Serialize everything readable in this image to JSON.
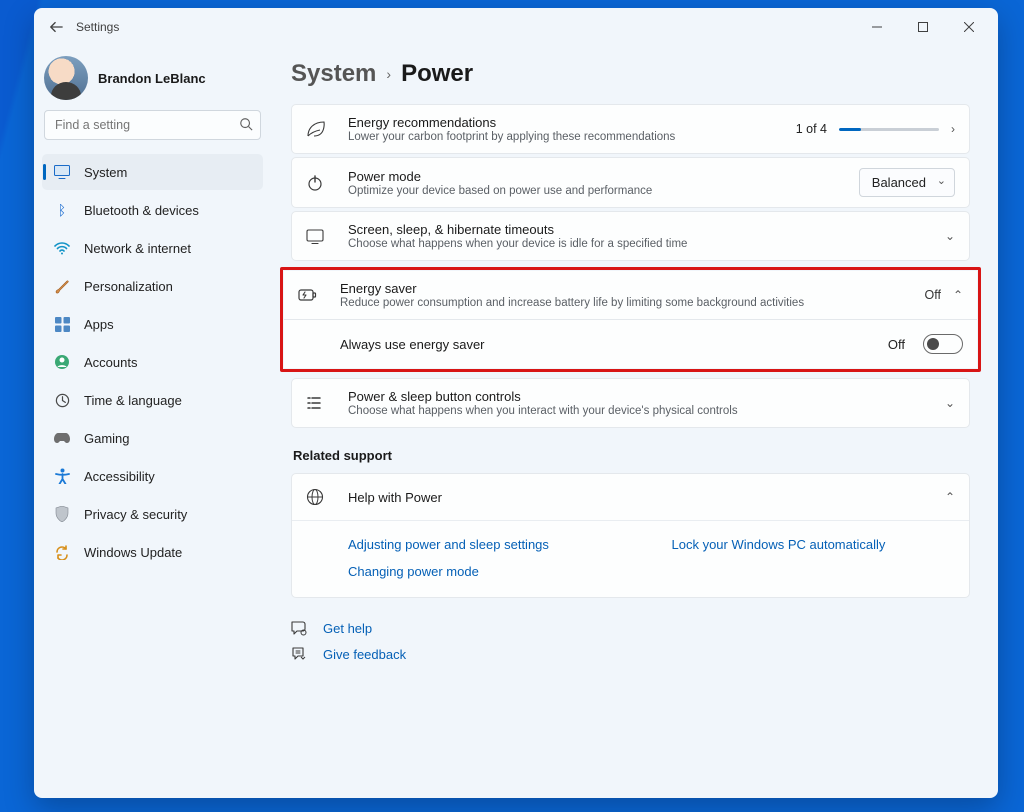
{
  "window": {
    "title": "Settings"
  },
  "profile": {
    "name": "Brandon LeBlanc"
  },
  "search": {
    "placeholder": "Find a setting"
  },
  "sidebar": {
    "items": [
      {
        "label": "System"
      },
      {
        "label": "Bluetooth & devices"
      },
      {
        "label": "Network & internet"
      },
      {
        "label": "Personalization"
      },
      {
        "label": "Apps"
      },
      {
        "label": "Accounts"
      },
      {
        "label": "Time & language"
      },
      {
        "label": "Gaming"
      },
      {
        "label": "Accessibility"
      },
      {
        "label": "Privacy & security"
      },
      {
        "label": "Windows Update"
      }
    ]
  },
  "breadcrumb": {
    "parent": "System",
    "page": "Power"
  },
  "cards": {
    "energyRec": {
      "title": "Energy recommendations",
      "sub": "Lower your carbon footprint by applying these recommendations",
      "counter": "1 of 4"
    },
    "powerMode": {
      "title": "Power mode",
      "sub": "Optimize your device based on power use and performance",
      "value": "Balanced"
    },
    "screenSleep": {
      "title": "Screen, sleep, & hibernate timeouts",
      "sub": "Choose what happens when your device is idle for a specified time"
    },
    "energySaver": {
      "title": "Energy saver",
      "sub": "Reduce power consumption and increase battery life by limiting some background activities",
      "state": "Off",
      "sub_title": "Always use energy saver",
      "toggle_state": "Off"
    },
    "powerButtons": {
      "title": "Power & sleep button controls",
      "sub": "Choose what happens when you interact with your device's physical controls"
    }
  },
  "related": {
    "heading": "Related support"
  },
  "support": {
    "title": "Help with Power",
    "links": [
      "Adjusting power and sleep settings",
      "Lock your Windows PC automatically",
      "Changing power mode"
    ]
  },
  "footer": {
    "getHelp": "Get help",
    "feedback": "Give feedback"
  }
}
